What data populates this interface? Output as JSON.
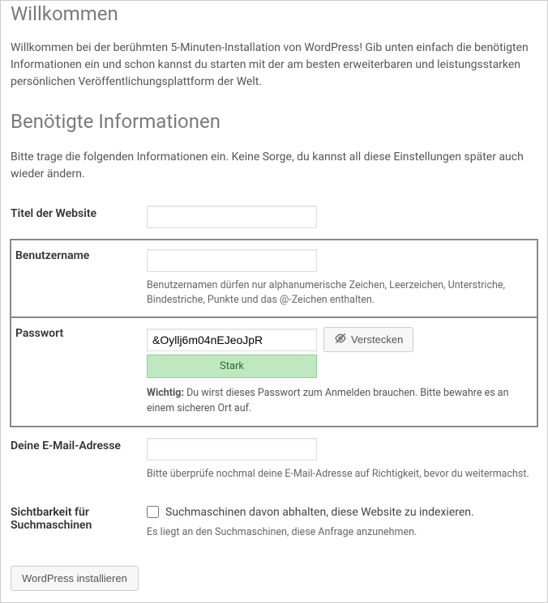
{
  "headings": {
    "welcome": "Willkommen",
    "required_info": "Benötigte Informationen"
  },
  "intro": {
    "welcome_text": "Willkommen bei der berühmten 5-Minuten-Installation von WordPress! Gib unten einfach die benötigten Informationen ein und schon kannst du starten mit der am besten erweiterbaren und leistungsstarken persönlichen Veröffentlichungsplattform der Welt.",
    "required_text": "Bitte trage die folgenden Informationen ein. Keine Sorge, du kannst all diese Einstellungen später auch wieder ändern."
  },
  "fields": {
    "site_title": {
      "label": "Titel der Website",
      "value": ""
    },
    "username": {
      "label": "Benutzername",
      "value": "",
      "hint": "Benutzernamen dürfen nur alphanumerische Zeichen, Leerzeichen, Unterstriche, Bindestriche, Punkte und das @-Zeichen enthalten."
    },
    "password": {
      "label": "Passwort",
      "value": "&Oyllj6m04nEJeoJpR",
      "hide_button": "Verstecken",
      "strength": "Stark",
      "note_strong": "Wichtig:",
      "note_rest": " Du wirst dieses Passwort zum Anmelden brauchen. Bitte bewahre es an einem sicheren Ort auf."
    },
    "email": {
      "label": "Deine E-Mail-Adresse",
      "value": "",
      "hint": "Bitte überprüfe nochmal deine E-Mail-Adresse auf Richtigkeit, bevor du weitermachst."
    },
    "visibility": {
      "label": "Sichtbarkeit für Suchmaschinen",
      "checkbox_label": "Suchmaschinen davon abhalten, diese Website zu indexieren.",
      "hint": "Es liegt an den Suchmaschinen, diese Anfrage anzunehmen."
    }
  },
  "submit": {
    "label": "WordPress installieren"
  }
}
